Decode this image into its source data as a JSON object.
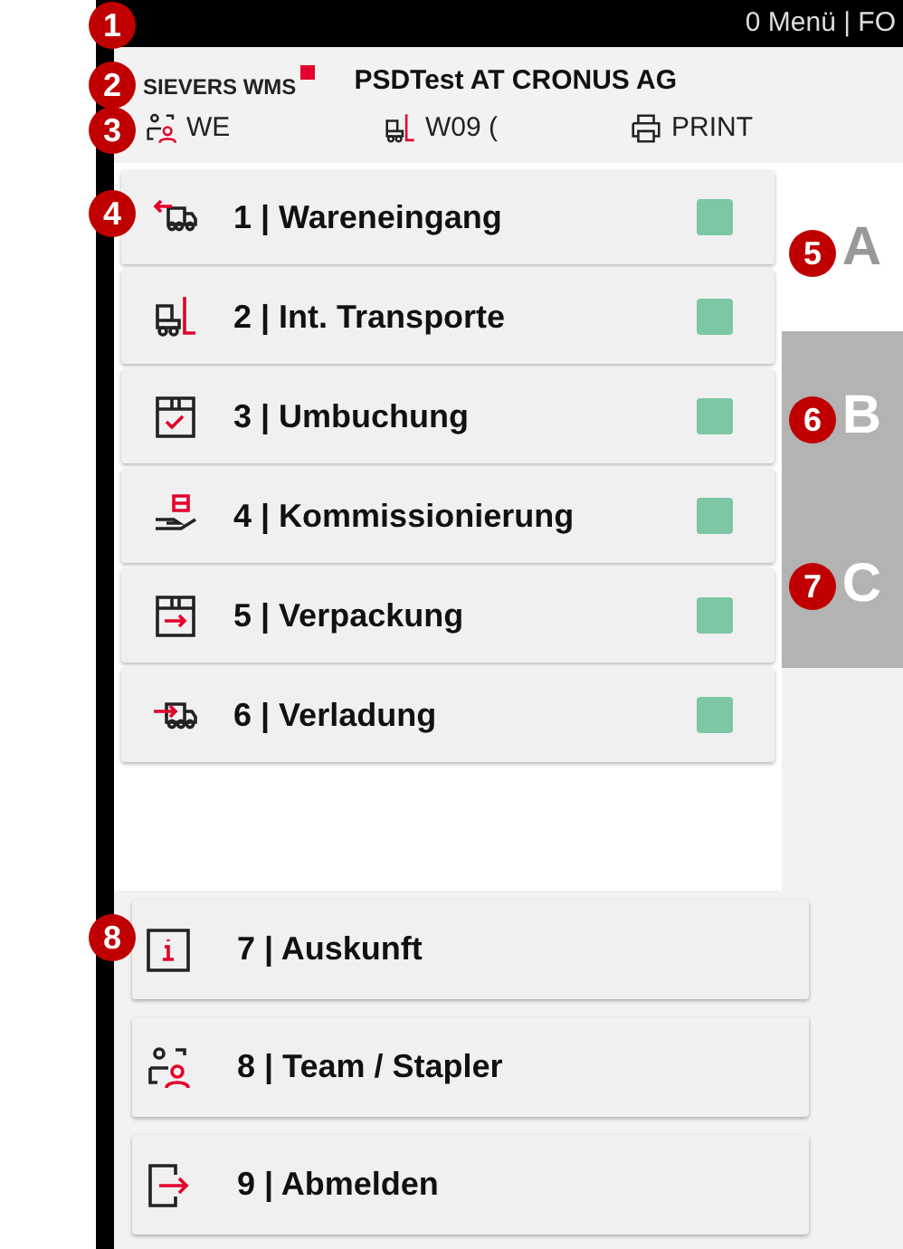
{
  "top_bar": {
    "text": "0 Menü | FO"
  },
  "header": {
    "brand": "SIEVERS WMS",
    "title": "PSDTest AT CRONUS AG",
    "info": [
      {
        "kind": "team",
        "text": "WE"
      },
      {
        "kind": "forklift",
        "text": "W09 ("
      },
      {
        "kind": "printer",
        "text": "PRINT"
      }
    ]
  },
  "menu_items": [
    {
      "kind": "inbound",
      "label": "1 | Wareneingang",
      "color": "#7dc7a4"
    },
    {
      "kind": "forklift",
      "label": "2 | Int. Transporte",
      "color": "#7dc7a4"
    },
    {
      "kind": "box-check",
      "label": "3 | Umbuchung",
      "color": "#7dc7a4"
    },
    {
      "kind": "picking",
      "label": "4 | Kommissionierung",
      "color": "#7dc7a4"
    },
    {
      "kind": "box-arrow",
      "label": "5 | Verpackung",
      "color": "#7dc7a4"
    },
    {
      "kind": "outbound",
      "label": "6 | Verladung",
      "color": "#7dc7a4"
    }
  ],
  "side_tabs": [
    {
      "label": "A",
      "selected": true
    },
    {
      "label": "B",
      "selected": false
    },
    {
      "label": "C",
      "selected": false
    }
  ],
  "bottom_items": [
    {
      "kind": "info",
      "label": "7 | Auskunft"
    },
    {
      "kind": "team",
      "label": "8 | Team / Stapler"
    },
    {
      "kind": "logout",
      "label": "9 | Abmelden"
    }
  ],
  "markers": [
    {
      "label": "1"
    },
    {
      "label": "2"
    },
    {
      "label": "3"
    },
    {
      "label": "4"
    },
    {
      "label": "5"
    },
    {
      "label": "6"
    },
    {
      "label": "7"
    },
    {
      "label": "8"
    }
  ]
}
